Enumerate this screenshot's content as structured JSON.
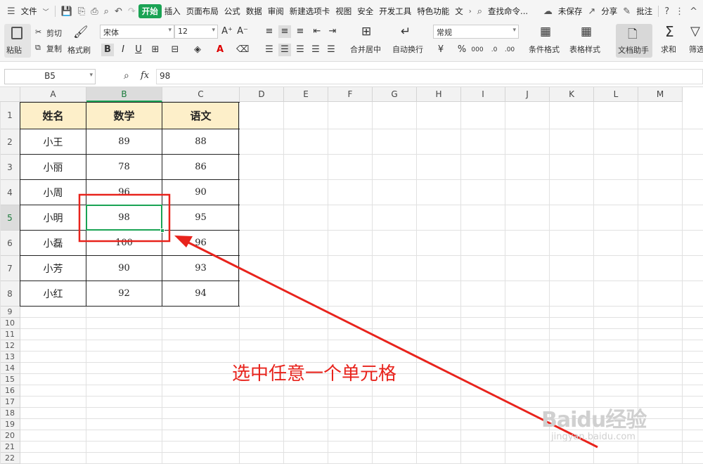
{
  "menu": {
    "items": [
      "文件",
      "开始",
      "插入",
      "页面布局",
      "公式",
      "数据",
      "审阅",
      "新建选项卡",
      "视图",
      "安全",
      "开发工具",
      "特色功能",
      "文"
    ],
    "search": "查找命令...",
    "unsaved": "未保存",
    "share": "分享",
    "comment": "批注"
  },
  "ribbon": {
    "paste": "粘贴",
    "cut": "剪切",
    "copy": "复制",
    "format_painter": "格式刷",
    "font_name": "宋体",
    "font_size": "12",
    "merge_center": "合并居中",
    "wrap_text": "自动换行",
    "number_format": "常规",
    "conditional_format": "条件格式",
    "table_style": "表格样式",
    "doc_assistant": "文档助手",
    "sum": "求和",
    "filter": "筛选"
  },
  "formula_bar": {
    "name_box": "B5",
    "fx": "fx",
    "value": "98"
  },
  "columns": [
    "A",
    "B",
    "C",
    "D",
    "E",
    "F",
    "G",
    "H",
    "I",
    "J",
    "K",
    "L",
    "M"
  ],
  "rows": [
    "1",
    "2",
    "3",
    "4",
    "5",
    "6",
    "7",
    "8",
    "9",
    "10",
    "11",
    "12",
    "13",
    "14",
    "15",
    "16",
    "17",
    "18",
    "19",
    "20",
    "21",
    "22"
  ],
  "table": {
    "headers": [
      "姓名",
      "数学",
      "语文"
    ],
    "data": [
      [
        "小王",
        "89",
        "88"
      ],
      [
        "小丽",
        "78",
        "86"
      ],
      [
        "小周",
        "96",
        "90"
      ],
      [
        "小明",
        "98",
        "95"
      ],
      [
        "小磊",
        "100",
        "96"
      ],
      [
        "小芳",
        "90",
        "93"
      ],
      [
        "小红",
        "92",
        "94"
      ]
    ]
  },
  "selected_cell": "B5",
  "annotation": "选中任意一个单元格",
  "watermark": {
    "brand": "Baidu经验",
    "url": "jingyan.baidu.com"
  },
  "colors": {
    "accent": "#1aa354",
    "header_fill": "#fdefc9",
    "annotation": "#e8231c"
  }
}
